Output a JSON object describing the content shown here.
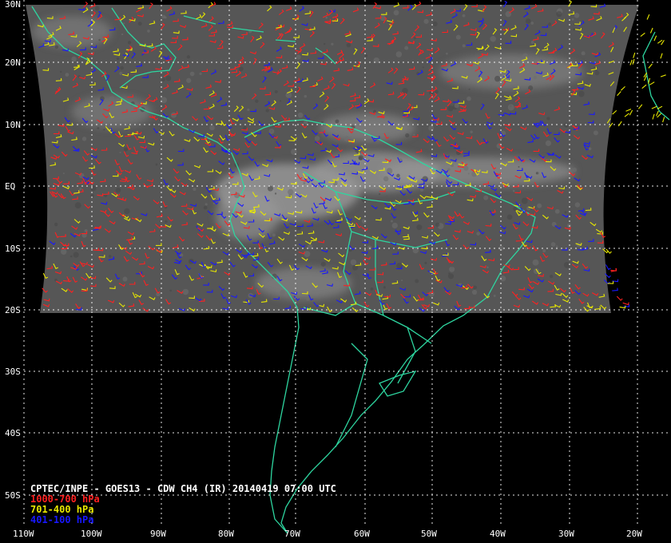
{
  "title": "CPTEC/INPE - GOES13 - CDW CH4 (IR) 20140419 07:00 UTC",
  "legend": [
    {
      "label": "1000-700 hPa",
      "color": "#ff2020"
    },
    {
      "label": "701-400 hPa",
      "color": "#e8e800"
    },
    {
      "label": "401-100 hPa",
      "color": "#1818ff"
    }
  ],
  "lat_labels": [
    "30N",
    "20N",
    "10N",
    "EQ",
    "10S",
    "20S",
    "30S",
    "40S",
    "50S"
  ],
  "lon_labels": [
    "110W",
    "100W",
    "90W",
    "80W",
    "70W",
    "60W",
    "50W",
    "40W",
    "30W",
    "20W"
  ],
  "colors": {
    "background": "#000000",
    "coastline": "#2ed6a0",
    "grid": "#ffffff",
    "satellite_imagery": "#5a5a5a"
  }
}
